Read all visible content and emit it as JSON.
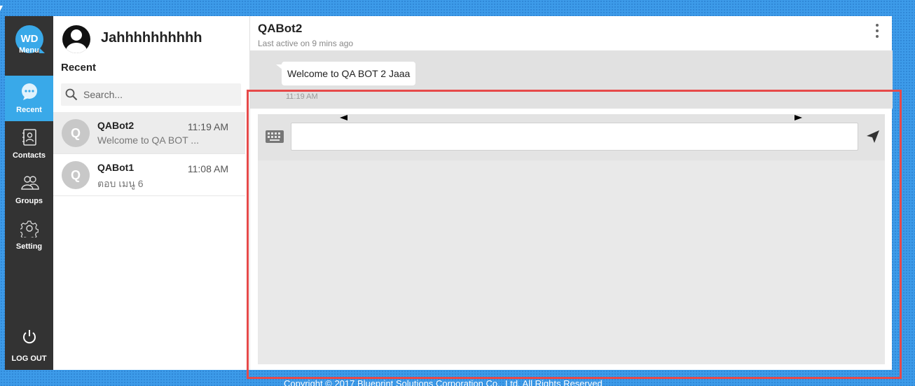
{
  "nav": {
    "logo": "WD",
    "items": [
      {
        "label": "Menu",
        "icon": "wd-logo-icon"
      },
      {
        "label": "Recent",
        "icon": "chat-bubble-icon",
        "active": true
      },
      {
        "label": "Contacts",
        "icon": "contacts-icon"
      },
      {
        "label": "Groups",
        "icon": "groups-icon"
      },
      {
        "label": "Setting",
        "icon": "gear-icon"
      }
    ],
    "logout": "LOG OUT"
  },
  "profile": {
    "name": "Jahhhhhhhhhh"
  },
  "recent": {
    "title": "Recent",
    "search_placeholder": "Search...",
    "conversations": [
      {
        "initial": "Q",
        "name": "QABot2",
        "time": "11:19 AM",
        "preview": "Welcome to QA BOT ...",
        "active": true
      },
      {
        "initial": "Q",
        "name": "QABot1",
        "time": "11:08 AM",
        "preview": "ตอบ เมนู 6",
        "active": false
      }
    ]
  },
  "chat": {
    "title": "QABot2",
    "status": "Last active on 9 mins ago",
    "messages": [
      {
        "text": "Welcome to QA BOT 2 Jaaa",
        "time": "11:19 AM"
      }
    ]
  },
  "footer": {
    "text": "Copyright © 2017 Blueprint Solutions Corporation Co., Ltd. All Rights Reserved"
  },
  "colors": {
    "accent": "#39a9e9",
    "nav_bg": "#333333",
    "highlight": "#e64a4a",
    "page_bg": "#3d9be9"
  }
}
